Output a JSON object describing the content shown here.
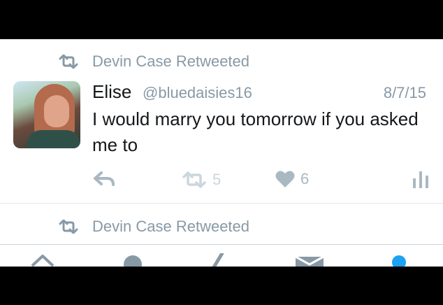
{
  "retweet_notice_1": "Devin Case Retweeted",
  "tweet": {
    "name": "Elise",
    "handle": "@bluedaisies16",
    "date": "8/7/15",
    "text": "I would marry you tomorrow if you asked me to",
    "retweet_count": "5",
    "like_count": "6"
  },
  "retweet_notice_2": "Devin Case Retweeted",
  "colors": {
    "secondary_text": "#8899a6",
    "action_icon": "#aab8c2",
    "divider": "#e1e8ed",
    "tab_active": "#1da1f2"
  },
  "icons": {
    "retweet_notice": "retweet-icon",
    "reply": "reply-icon",
    "retweet": "retweet-icon",
    "like": "heart-icon",
    "stats": "analytics-icon",
    "tabs": [
      "home-icon",
      "moments-icon",
      "compose-icon",
      "messages-icon",
      "profile-icon"
    ]
  }
}
